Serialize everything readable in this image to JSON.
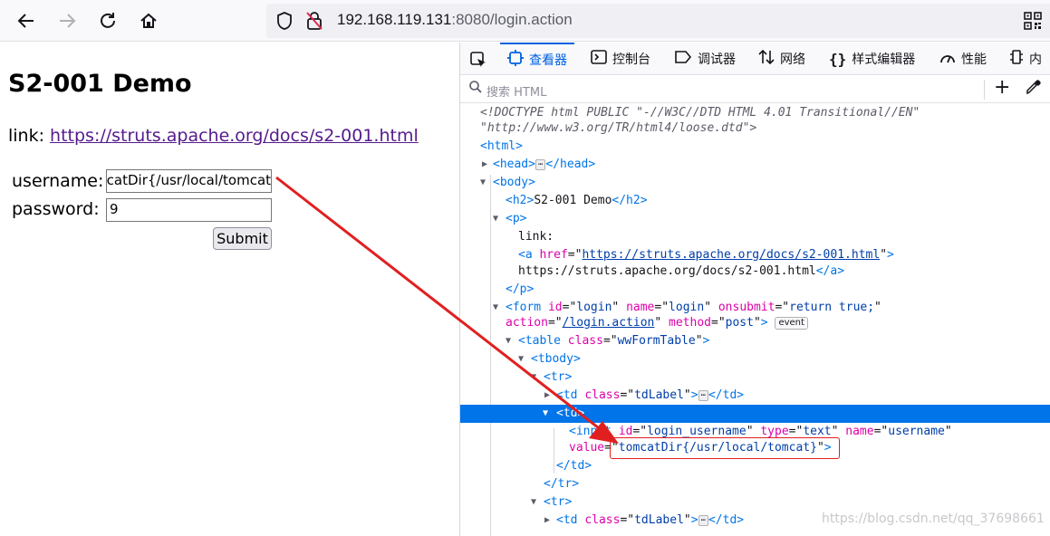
{
  "browser": {
    "url_host": "192.168.119.131",
    "url_rest": ":8080/login.action"
  },
  "page": {
    "title": "S2-001 Demo",
    "link_prefix": "link: ",
    "link_text": "https://struts.apache.org/docs/s2-001.html",
    "username_label": "username:",
    "username_value": "tomcatDir{/usr/local/tomcat}",
    "password_label": "password:",
    "password_value": "9",
    "submit_label": "Submit"
  },
  "devtools": {
    "tabs": [
      {
        "label": "查看器",
        "icon": "inspector-icon"
      },
      {
        "label": "控制台",
        "icon": "console-icon"
      },
      {
        "label": "调试器",
        "icon": "debugger-icon"
      },
      {
        "label": "网络",
        "icon": "network-icon"
      },
      {
        "label": "样式编辑器",
        "icon": "style-editor-icon"
      },
      {
        "label": "性能",
        "icon": "performance-icon"
      },
      {
        "label": "内",
        "icon": "memory-icon"
      }
    ],
    "search_placeholder": "搜索 HTML",
    "markup": {
      "doctype_1": "<!DOCTYPE html PUBLIC \"-//W3C//DTD HTML 4.01 Transitional//EN\"",
      "doctype_2": "\"http://www.w3.org/TR/html4/loose.dtd\">",
      "html_open": "<html>",
      "head_open": "<head>",
      "head_close": "</head>",
      "body_open": "<body>",
      "h2_open": "<h2>",
      "h2_text": "S2-001 Demo",
      "h2_close": "</h2>",
      "p_open": "<p>",
      "p_text": "link:",
      "a_open": "<a ",
      "a_attr": "href",
      "a_href": "https://struts.apache.org/docs/s2-001.html",
      "a_text": "https://struts.apache.org/docs/s2-001.html",
      "a_close": "</a>",
      "p_close": "</p>",
      "form_open": "<form ",
      "form_id_attr": "id",
      "form_id_val": "login",
      "form_name_attr": "name",
      "form_name_val": "login",
      "form_onsubmit_attr": "onsubmit",
      "form_onsubmit_val": "return true;",
      "form_action_attr": "action",
      "form_action_val": "/login.action",
      "form_method_attr": "method",
      "form_method_val": "post",
      "event_badge": "event",
      "table_open": "<table ",
      "table_class_attr": "class",
      "table_class_val": "wwFormTable",
      "tbody_open": "<tbody>",
      "tr_open": "<tr>",
      "td_open": "<td ",
      "td_class_attr": "class",
      "td_class_val": "tdLabel",
      "td_close": "</td>",
      "td_selected": "<td>",
      "input_open": "<input ",
      "input_id_attr": "id",
      "input_id_val": "login_username",
      "input_type_attr": "type",
      "input_type_val": "text",
      "input_name_attr": "name",
      "input_name_val": "username",
      "input_value_attr": "value",
      "input_value_val": "tomcatDir{/usr/local/tomcat}",
      "tr_close": "</tr>",
      "ellipsis": "⋯"
    }
  },
  "watermark": "https://blog.csdn.net/qq_37698661",
  "colors": {
    "accent": "#0061e0",
    "selection": "#0074e8",
    "annotation": "#e02020"
  }
}
